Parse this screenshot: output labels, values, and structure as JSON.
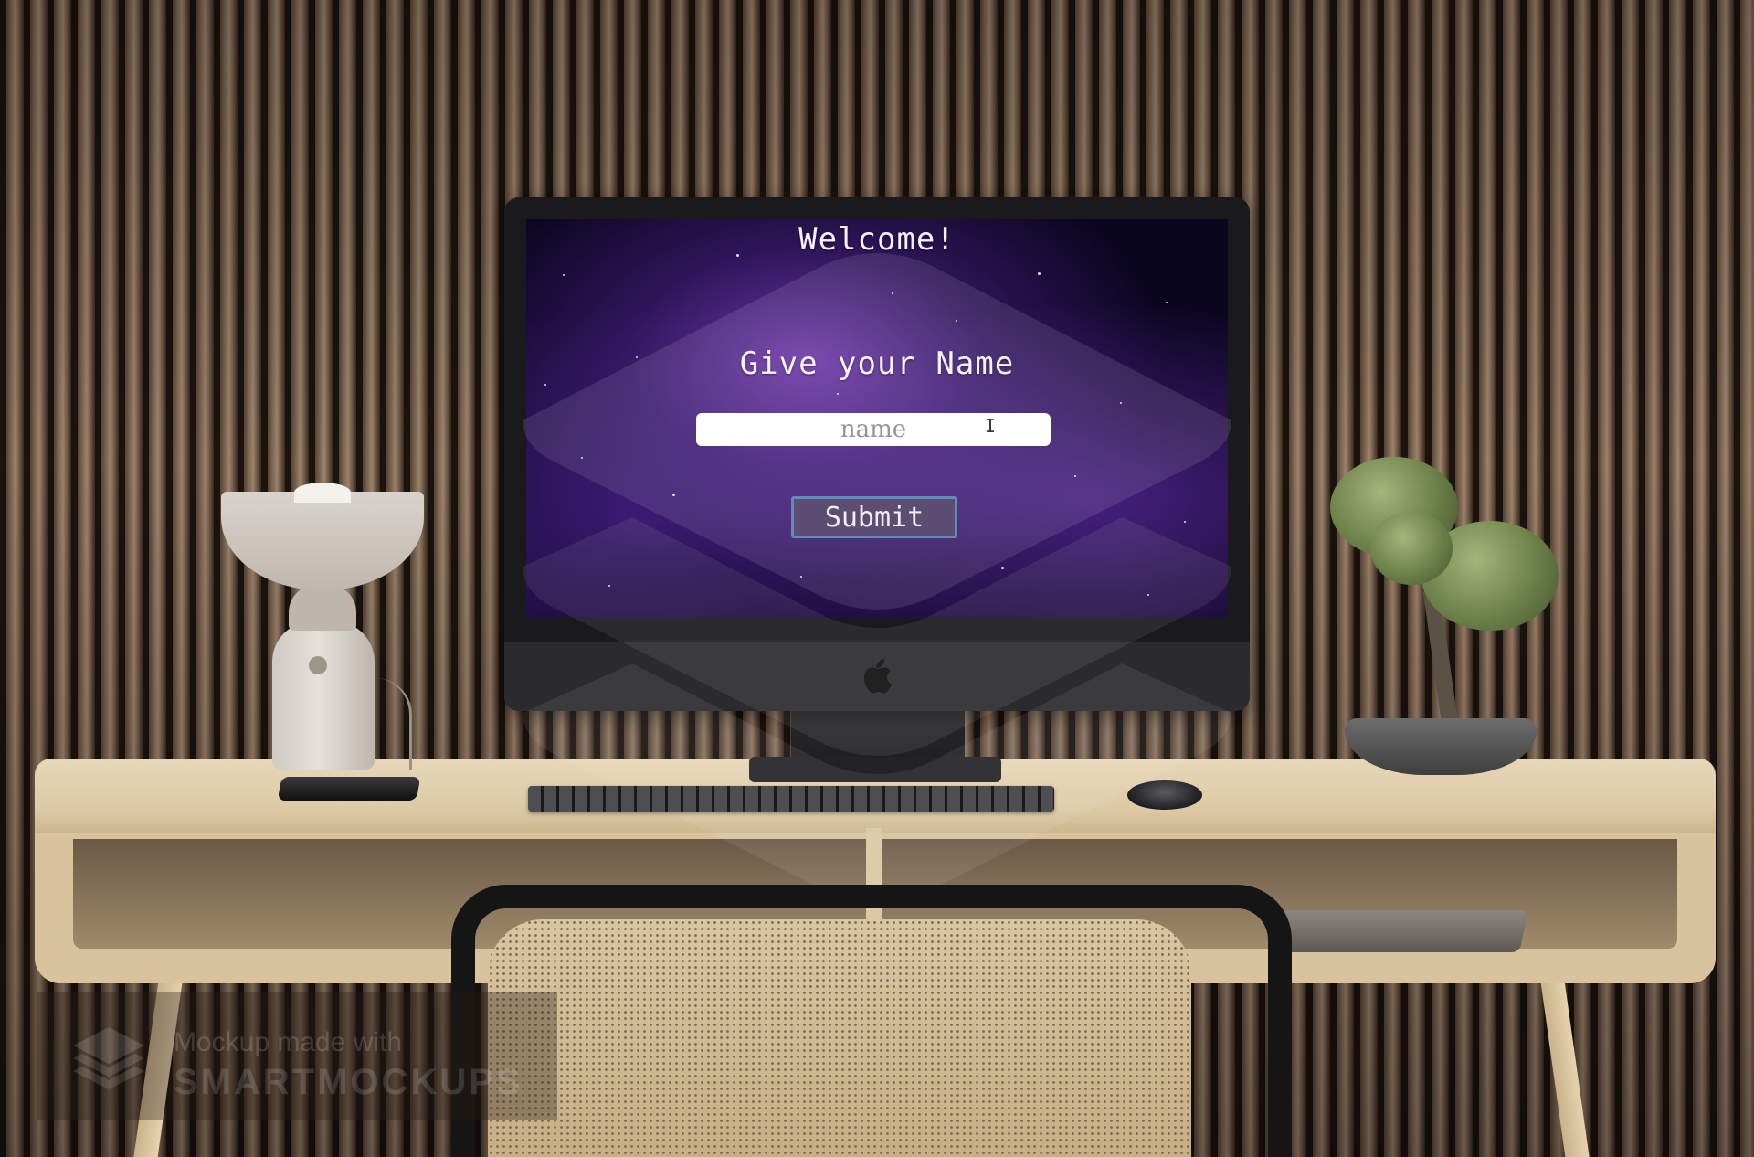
{
  "screen": {
    "heading": "Welcome!",
    "prompt": "Give your Name",
    "name_input": {
      "value": "",
      "placeholder": "name"
    },
    "submit_label": "Submit"
  },
  "watermark": {
    "line1": "Mockup made with",
    "line2": "SMARTMOCKUPS"
  },
  "colors": {
    "screen_background": "#0b0620",
    "nebula_purple": "#8c46d2",
    "button_fill": "#4a3a64",
    "button_border": "#4f7fb4",
    "desk_wood": "#dcc9a4"
  },
  "icons": {
    "monitor_logo": "apple-logo-icon",
    "watermark_logo": "layers-stack-icon",
    "text_cursor": "text-cursor-icon"
  }
}
